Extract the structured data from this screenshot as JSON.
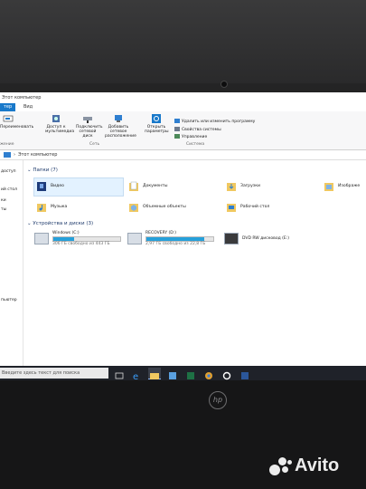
{
  "window": {
    "title": "Этот компьютер",
    "tabs": [
      "тер",
      "Вид"
    ],
    "active_tab": 0
  },
  "ribbon": {
    "buttons": [
      {
        "label": "Переименовать",
        "icon": "rename-icon"
      },
      {
        "label": "Доступ к мультимедиа",
        "icon": "media-icon"
      },
      {
        "label": "Подключить сетевой диск",
        "icon": "network-drive-icon"
      },
      {
        "label": "Добавить сетевое расположение",
        "icon": "network-location-icon"
      },
      {
        "label": "Открыть параметры",
        "icon": "settings-icon"
      }
    ],
    "system_items": [
      {
        "label": "Удалить или изменить программу",
        "icon": "uninstall-icon"
      },
      {
        "label": "Свойства системы",
        "icon": "system-icon"
      },
      {
        "label": "Управление",
        "icon": "manage-icon"
      }
    ],
    "groups": [
      "Сеть",
      "Система"
    ],
    "left_fragment": "жение"
  },
  "address": {
    "path": "Этот компьютер"
  },
  "nav": {
    "items": [
      "доступ",
      "",
      "ий стол",
      "ки",
      "ты",
      "ження"
    ]
  },
  "folders": {
    "header": "Папки (7)",
    "items": [
      {
        "label": "Видео",
        "icon": "video-folder-icon",
        "selected": true
      },
      {
        "label": "Документы",
        "icon": "documents-folder-icon",
        "selected": false
      },
      {
        "label": "Загрузки",
        "icon": "downloads-folder-icon",
        "selected": false
      },
      {
        "label": "Изображе",
        "icon": "pictures-folder-icon",
        "selected": false
      },
      {
        "label": "Музыка",
        "icon": "music-folder-icon",
        "selected": false
      },
      {
        "label": "Объемные объекты",
        "icon": "3d-objects-folder-icon",
        "selected": false
      },
      {
        "label": "Рабочий стол",
        "icon": "desktop-folder-icon",
        "selected": false
      }
    ]
  },
  "drives": {
    "header": "Устройства и диски (3)",
    "items": [
      {
        "name": "Windows (C:)",
        "free": "306 ГБ свободно из 443 ГБ",
        "used_fraction": 0.31
      },
      {
        "name": "RECOVERY (D:)",
        "free": "2,97 ГБ свободно из 22,8 ГБ",
        "used_fraction": 0.87
      },
      {
        "name": "DVD RW дисковод (E:)",
        "free": "",
        "used_fraction": null
      }
    ]
  },
  "statusbar": {
    "text": "пьютер"
  },
  "taskbar": {
    "search_placeholder": "Введите здесь текст для поиска"
  },
  "brand": {
    "laptop_logo": "hp",
    "watermark": "Avito"
  },
  "colors": {
    "accent": "#1979ca",
    "drive_fill": "#26a0da"
  }
}
